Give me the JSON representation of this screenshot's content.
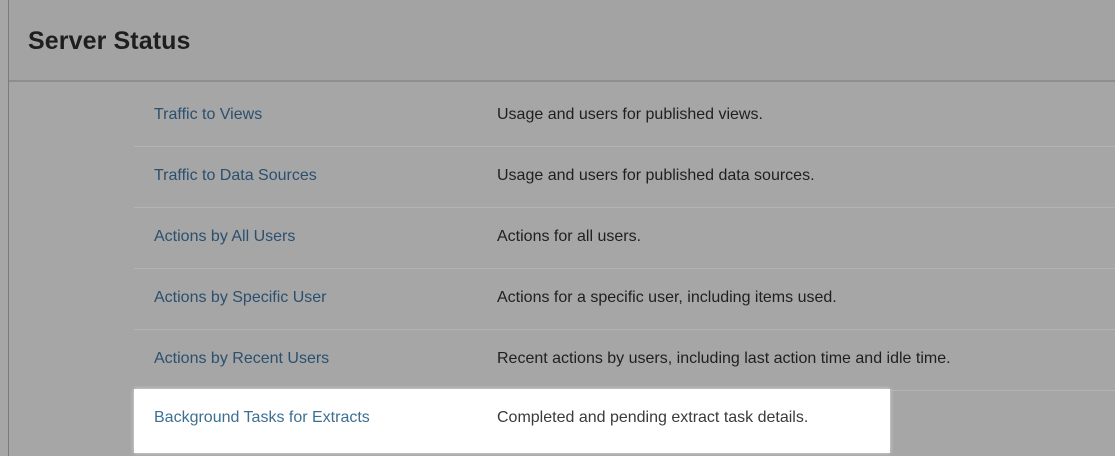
{
  "header": {
    "title": "Server Status"
  },
  "reports": [
    {
      "name": "Traffic to Views",
      "description": "Usage and users for published views."
    },
    {
      "name": "Traffic to Data Sources",
      "description": "Usage and users for published data sources."
    },
    {
      "name": "Actions by All Users",
      "description": "Actions for all users."
    },
    {
      "name": "Actions by Specific User",
      "description": "Actions for a specific user, including items used."
    },
    {
      "name": "Actions by Recent Users",
      "description": "Recent actions by users, including last action time and idle time."
    },
    {
      "name": "Background Tasks for Extracts",
      "description": "Completed and pending extract task details."
    }
  ],
  "colors": {
    "background": "#a6a6a6",
    "link": "#2b4f6e",
    "highlight": "#ffffff"
  }
}
